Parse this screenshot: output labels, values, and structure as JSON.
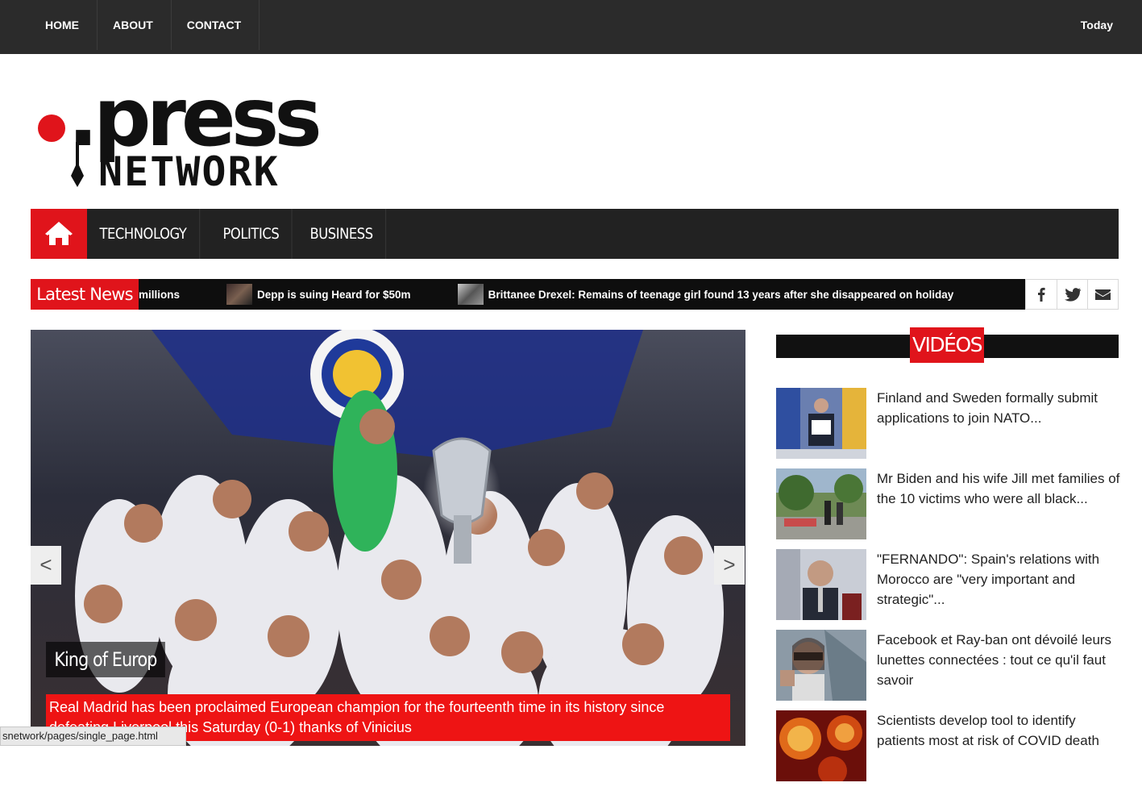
{
  "topbar": {
    "nav": [
      "HOME",
      "ABOUT",
      "CONTACT"
    ],
    "date_label": "Today"
  },
  "logo": {
    "word_top": ".press",
    "word_bottom": "NETWORK"
  },
  "mainnav": {
    "items": [
      "TECHNOLOGY",
      "POLITICS",
      "BUSINESS"
    ]
  },
  "ticker": {
    "label": "Latest News",
    "items": [
      "millions",
      "Depp is suing Heard for $50m",
      "Brittanee Drexel: Remains of teenage girl found 13 years after she disappeared on holiday"
    ]
  },
  "slider": {
    "title": "King of Europ",
    "caption": "Real Madrid has been proclaimed European champion for the fourteenth time in its history since defeating Liverpool this Saturday (0-1) thanks of Vinicius",
    "prev": "<",
    "next": ">"
  },
  "status_url": "snetwork/pages/single_page.html",
  "videos": {
    "title": "VIDÉOS",
    "items": [
      "Finland and Sweden formally submit applications to join NATO...",
      "Mr Biden and his wife Jill met families of the 10 victims who were all black...",
      "\"FERNANDO\": Spain's relations with Morocco are \"very important and strategic\"...",
      "Facebook et Ray-ban ont dévoilé leurs lunettes connectées : tout ce qu'il faut savoir",
      "Scientists develop tool to identify patients most at risk of COVID death"
    ]
  },
  "colors": {
    "brand_red": "#e0141b",
    "dark": "#2b2b2b"
  }
}
